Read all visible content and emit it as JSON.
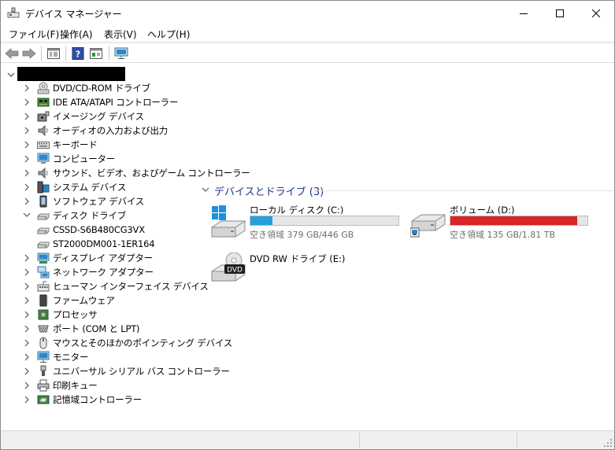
{
  "window": {
    "title": "デバイス マネージャー",
    "controls": {
      "minimize": "—",
      "maximize": "☐",
      "close": "✕"
    }
  },
  "menu": [
    {
      "label": "ファイル(F)"
    },
    {
      "label": "操作(A)"
    },
    {
      "label": "表示(V)"
    },
    {
      "label": "ヘルプ(H)"
    }
  ],
  "toolbar": {
    "buttons": [
      "back-arrow-icon",
      "forward-arrow-icon",
      "properties-icon",
      "help-icon",
      "view-icon",
      "monitor-icon"
    ]
  },
  "tree": {
    "root_label": "",
    "items": [
      {
        "label": "DVD/CD-ROM ドライブ",
        "icon": "dvd-drive-icon",
        "expanded": false
      },
      {
        "label": "IDE ATA/ATAPI コントローラー",
        "icon": "ide-controller-icon",
        "expanded": false
      },
      {
        "label": "イメージング デバイス",
        "icon": "camera-icon",
        "expanded": false
      },
      {
        "label": "オーディオの入力および出力",
        "icon": "speaker-icon",
        "expanded": false
      },
      {
        "label": "キーボード",
        "icon": "keyboard-icon",
        "expanded": false
      },
      {
        "label": "コンピューター",
        "icon": "computer-icon",
        "expanded": false
      },
      {
        "label": "サウンド、ビデオ、およびゲーム コントローラー",
        "icon": "speaker-icon",
        "expanded": false
      },
      {
        "label": "システム デバイス",
        "icon": "system-device-icon",
        "expanded": false
      },
      {
        "label": "ソフトウェア デバイス",
        "icon": "software-device-icon",
        "expanded": false
      },
      {
        "label": "ディスク ドライブ",
        "icon": "disk-drive-icon",
        "expanded": true,
        "children": [
          {
            "label": "CSSD-S6B480CG3VX",
            "icon": "disk-drive-icon"
          },
          {
            "label": "ST2000DM001-1ER164",
            "icon": "disk-drive-icon"
          }
        ]
      },
      {
        "label": "ディスプレイ アダプター",
        "icon": "display-adapter-icon",
        "expanded": false
      },
      {
        "label": "ネットワーク アダプター",
        "icon": "network-adapter-icon",
        "expanded": false
      },
      {
        "label": "ヒューマン インターフェイス デバイス",
        "icon": "hid-icon",
        "expanded": false
      },
      {
        "label": "ファームウェア",
        "icon": "firmware-icon",
        "expanded": false
      },
      {
        "label": "プロセッサ",
        "icon": "processor-icon",
        "expanded": false
      },
      {
        "label": "ポート (COM と LPT)",
        "icon": "port-icon",
        "expanded": false
      },
      {
        "label": "マウスとそのほかのポインティング デバイス",
        "icon": "mouse-icon",
        "expanded": false
      },
      {
        "label": "モニター",
        "icon": "monitor-icon",
        "expanded": false
      },
      {
        "label": "ユニバーサル シリアル バス コントローラー",
        "icon": "usb-icon",
        "expanded": false
      },
      {
        "label": "印刷キュー",
        "icon": "printer-icon",
        "expanded": false
      },
      {
        "label": "記憶域コントローラー",
        "icon": "storage-controller-icon",
        "expanded": false
      }
    ]
  },
  "drives_panel": {
    "header": "デバイスとドライブ (3)",
    "drives": [
      {
        "name": "ローカル ディスク (C:)",
        "free_text": "空き領域 379 GB/446 GB",
        "used_fraction": 0.15,
        "bar_color": "#26a0da",
        "icon": "windows-drive-icon"
      },
      {
        "name": "ボリューム (D:)",
        "free_text": "空き領域 135 GB/1.81 TB",
        "used_fraction": 0.927,
        "bar_color": "#da2626",
        "icon": "hdd-icon"
      },
      {
        "name": "DVD RW ドライブ (E:)",
        "icon": "dvd-rw-drive-icon",
        "icon_label": "DVD"
      }
    ]
  }
}
